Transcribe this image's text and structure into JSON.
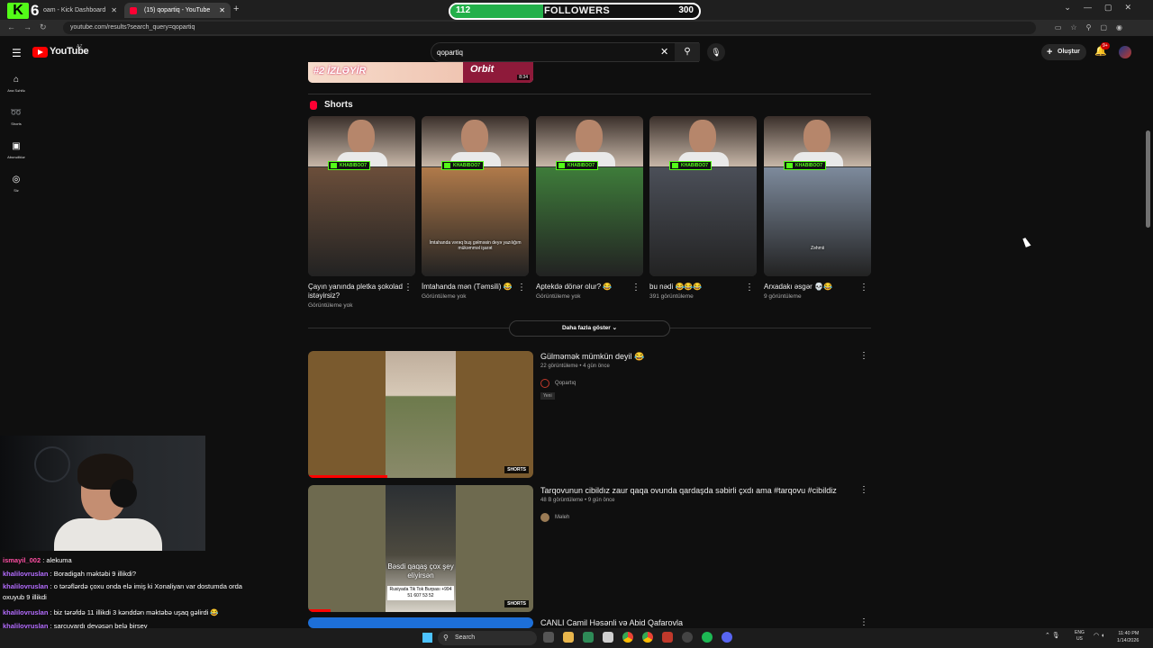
{
  "browser": {
    "tabs": [
      {
        "label": "oam - Kick Dashboard"
      },
      {
        "label": "(15) qopartiq - YouTube"
      }
    ],
    "url": "youtube.com/results?search_query=qopartiq"
  },
  "overlay": {
    "kick_count": "6",
    "followers_current": "112",
    "followers_label": "FOLLOWERS",
    "followers_goal": "300",
    "followers_progress": 0.373
  },
  "youtube": {
    "logo_text": "YouTube",
    "country_code": "AZ",
    "search_value": "qopartiq",
    "create_label": "Oluştur",
    "notif_badge": "9+",
    "sidebar": [
      {
        "label": "Ana Səhifə",
        "icon": "home-icon"
      },
      {
        "label": "Shorts",
        "icon": "shorts-icon"
      },
      {
        "label": "Abunəliklər",
        "icon": "subscriptions-icon"
      },
      {
        "label": "Siz",
        "icon": "user-icon"
      }
    ],
    "banner": {
      "text": "#2 İZLƏYİR",
      "brand": "Orbit",
      "duration": "8:34"
    },
    "shorts_heading": "Shorts",
    "shorts": [
      {
        "title": "Çayın yanında pletka şokolad istəyirsiz?",
        "meta": "Görüntüleme yok",
        "caption": "",
        "bg": "#6b4e3a"
      },
      {
        "title": "İmtahanda mən (Təmsili) 😂",
        "meta": "Görüntüleme yok",
        "caption": "İmtahanda vərəq buş gəlməsin deyə yazılığım mükəmməl işarət",
        "bg": "#b07a4a"
      },
      {
        "title": "Aptekdə dönər olur? 😂",
        "meta": "Görüntüleme yok",
        "caption": "",
        "bg": "#3e7c3a"
      },
      {
        "title": "bu nədi 😂😂😂",
        "meta": "391 görüntüleme",
        "caption": "",
        "bg": "#4b4f58"
      },
      {
        "title": "Arxadakı əsgər 💀😂",
        "meta": "9 görüntüleme",
        "caption": "Zəhmii",
        "bg": "#7d8a9c"
      }
    ],
    "shorts_tags": [
      "KHABIBOO7",
      "KHABIBOO7",
      "KHABIBOO7",
      "KHABIBOO7",
      "KHABIBOO7"
    ],
    "show_more": "Daha fazla göster",
    "videos": [
      {
        "title": "Gülməmək mümkün deyil 😂",
        "meta": "22 görüntüleme • 4 gün önce",
        "channel": "Qopartıq",
        "badge": "Yeni",
        "thumb_badge": "SHORTS",
        "bg": "#7a5a2e",
        "progress": 0.35
      },
      {
        "title": "Tarqovunun cibildız zaur qaqa ovunda qardaşda səbirli çxdı ama #tarqovu #cibildiz",
        "meta": "48 B görüntüleme • 9 gün önce",
        "channel": "Məleh",
        "thumb_badge": "SHORTS",
        "overlay_text": "Bəsdi qaqaş çox şey eliyirsən",
        "promo": "Rusiyada Tik Tok Burpası +994 51 607 53 52",
        "bg": "#6e6a4f",
        "progress": 0.1
      },
      {
        "title": "CANLI Camil Həsənli və Abid Qafarovla"
      }
    ]
  },
  "chat": [
    {
      "user": "ismayil_002",
      "text": ": alekuma",
      "color": "#ff4fa3"
    },
    {
      "user": "khalilovruslan",
      "text": ": Boradigah məktəbi 9 illikdi?",
      "color": "#b46cff"
    },
    {
      "user": "khalilovruslan",
      "text": ": o tərəflərdə çoxu onda elə imiş ki Xonaliyan var dostumda orda oxuyub 9 illikdi",
      "color": "#b46cff"
    },
    {
      "user": "khalilovruslan",
      "text": ": biz tərəfdə 11 illikdi 3 kənddən məktəbə uşaq gəlirdi 😂",
      "color": "#b46cff"
    },
    {
      "user": "khalilovruslan",
      "text": ": sarçuvardı deyəsən belə birşey",
      "color": "#b46cff"
    },
    {
      "user": "ismayil_002",
      "text": ": əə rv noldu",
      "color": "#ff4fa3"
    }
  ],
  "taskbar": {
    "search_label": "Search",
    "lang1": "ENG",
    "lang2": "US",
    "time": "11:40 PM",
    "date": "1/14/2026"
  }
}
